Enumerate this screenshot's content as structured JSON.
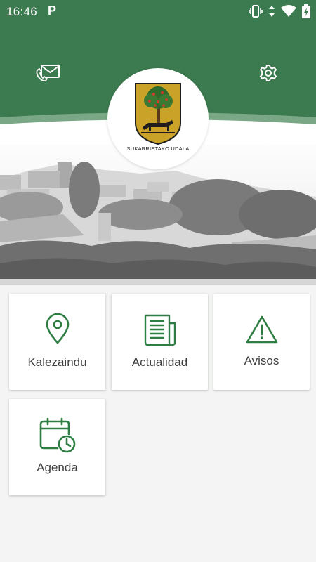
{
  "status_bar": {
    "time": "16:46",
    "notification_icon": "parking-p-icon",
    "icons": [
      "vibrate-icon",
      "data-arrows-icon",
      "wifi-icon",
      "battery-icon"
    ]
  },
  "header": {
    "contact_icon": "contact-mail-phone-icon",
    "settings_icon": "gear-icon",
    "logo_caption": "SUKARRIETAKO UDALA"
  },
  "colors": {
    "brand_green": "#3c7a4f",
    "icon_green": "#2e7d43"
  },
  "menu": [
    {
      "label": "Kalezaindu",
      "icon": "location-pin-icon"
    },
    {
      "label": "Actualidad",
      "icon": "newspaper-icon"
    },
    {
      "label": "Avisos",
      "icon": "warning-triangle-icon"
    },
    {
      "label": "Agenda",
      "icon": "calendar-clock-icon"
    }
  ]
}
